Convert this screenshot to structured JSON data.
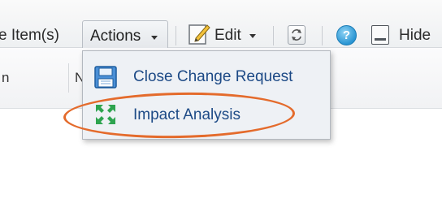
{
  "toolbar": {
    "remove_items_label": "e Item(s)",
    "actions_label": "Actions",
    "edit_label": "Edit",
    "hide_label": "Hide"
  },
  "grid": {
    "col1_header": "n",
    "col2_header": "N"
  },
  "actions_menu": {
    "items": [
      {
        "label": "Close Change Request",
        "icon": "save-icon"
      },
      {
        "label": "Impact Analysis",
        "icon": "impact-analysis-icon"
      }
    ]
  },
  "colors": {
    "menu_text": "#1d4a86",
    "highlight": "#e46b2c",
    "menu_bg": "#eef1f5"
  }
}
